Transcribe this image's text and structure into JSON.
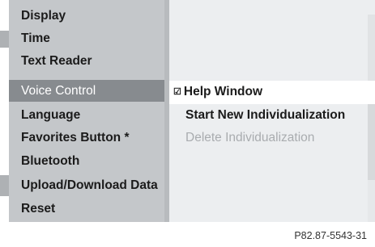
{
  "menu": {
    "items": [
      {
        "label": "Display",
        "selected": false
      },
      {
        "label": "Time",
        "selected": false
      },
      {
        "label": "Text Reader",
        "selected": false
      },
      {
        "label": "Voice Control",
        "selected": true
      },
      {
        "label": "Language",
        "selected": false
      },
      {
        "label": "Favorites Button *",
        "selected": false
      },
      {
        "label": "Bluetooth",
        "selected": false
      },
      {
        "label": "Upload/Download Data",
        "selected": false
      },
      {
        "label": "Reset",
        "selected": false
      }
    ]
  },
  "options": {
    "help_window": {
      "label": "Help Window",
      "checked": true,
      "check_glyph": "☑"
    },
    "start_new": {
      "label": "Start New Individualization",
      "enabled": true
    },
    "delete": {
      "label": "Delete Individualization",
      "enabled": false
    }
  },
  "figure_code": "P82.87-5543-31",
  "colors": {
    "selected_bg": "#878b8f",
    "menu_bg": "#c4c7ca",
    "content_bg": "#eceef0",
    "disabled_text": "#a9acaf"
  }
}
